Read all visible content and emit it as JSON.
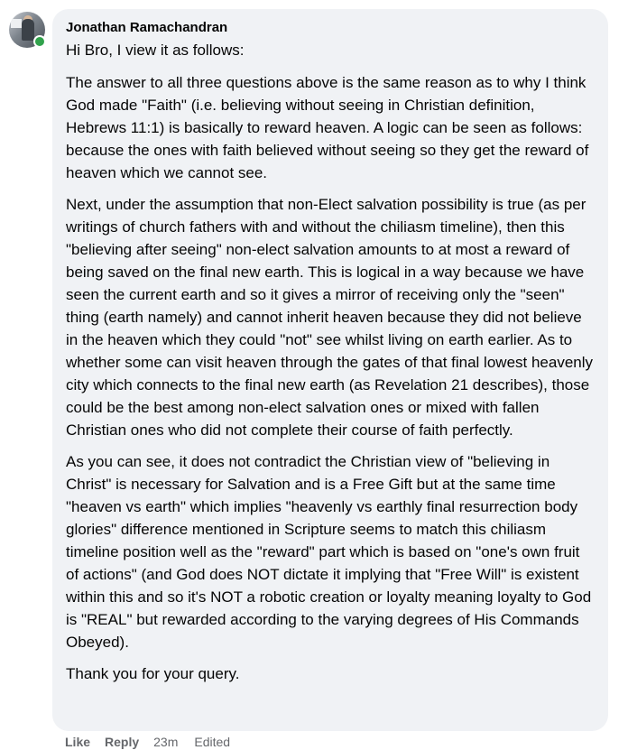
{
  "comment": {
    "author": "Jonathan Ramachandran",
    "avatar_icon": "user-avatar",
    "online_status_color": "#31a24c",
    "paragraphs": [
      "Hi Bro, I view it as follows:",
      "The answer to all three questions above is the same reason as to why I think God made \"Faith\" (i.e. believing without seeing in Christian definition, Hebrews 11:1) is basically to reward heaven. A logic can be seen as follows: because the ones with faith believed without seeing so they get the reward of heaven which we cannot see.",
      "Next, under the assumption that non-Elect salvation possibility is true (as per writings of church fathers with and without the chiliasm timeline), then this \"believing after seeing\" non-elect salvation amounts to at most a reward of being saved on the final new earth. This is logical in a way because we have seen the current earth and so it gives a mirror of receiving only the \"seen\" thing (earth namely) and cannot inherit heaven because they did not believe in the heaven which they could \"not\" see whilst living on earth earlier. As to whether some can visit heaven through the gates of that final lowest heavenly city which connects to the final new earth (as Revelation 21 describes), those could be the best among non-elect salvation ones or mixed with fallen Christian ones who did not complete their course of faith perfectly.",
      "As you can see, it does not contradict the Christian view of \"believing in Christ\" is necessary for Salvation and is a Free Gift but at the same time \"heaven vs earth\" which implies \"heavenly vs earthly final resurrection body glories\" difference mentioned in Scripture seems to match this chiliasm timeline position well as the \"reward\" part which is based on \"one's own fruit of actions\" (and God does NOT dictate it implying that \"Free Will\" is existent within this and so it's NOT a robotic creation or loyalty meaning loyalty to God is \"REAL\" but rewarded according to the varying degrees of His Commands Obeyed).",
      "Thank you for your query."
    ]
  },
  "actions": {
    "like_label": "Like",
    "reply_label": "Reply",
    "timestamp": "23m",
    "edited_label": "Edited"
  }
}
